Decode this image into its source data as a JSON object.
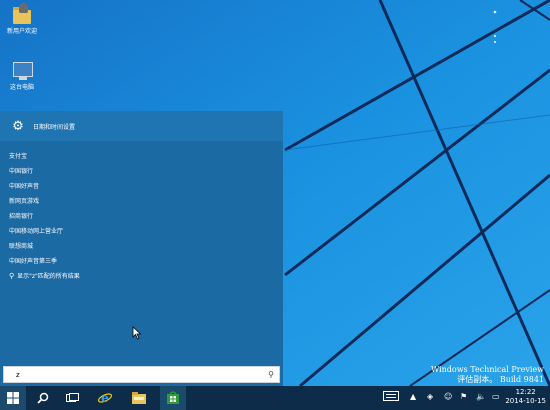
{
  "colors": {
    "desktop": "#1a8fdc",
    "start_menu": "#1c6aa3",
    "taskbar": "#0d2c4a"
  },
  "desktop": {
    "icons": [
      {
        "label": "新用户欢迎",
        "icon": "user-folder-icon"
      },
      {
        "label": "这台电脑",
        "icon": "computer-monitor-icon"
      }
    ]
  },
  "start_menu": {
    "settings_label": "日期和时间设置",
    "results": [
      "支付宝",
      "中国银行",
      "中国好声音",
      "新网页游戏",
      "招商银行",
      "中国移动网上营业厅",
      "联想商城",
      "中国好声音第三季"
    ],
    "search_web_label": "显示\"z\"匹配的所有结果",
    "search": {
      "value": "z"
    }
  },
  "watermark": {
    "line1": "Windows Technical Preview",
    "line2": "评估副本。 Build 9841"
  },
  "taskbar": {
    "time": "12:22",
    "date": "2014-10-15",
    "pinned": [
      "start-icon",
      "search-icon",
      "task-view-icon",
      "internet-explorer-icon",
      "file-explorer-icon",
      "store-icon"
    ]
  }
}
